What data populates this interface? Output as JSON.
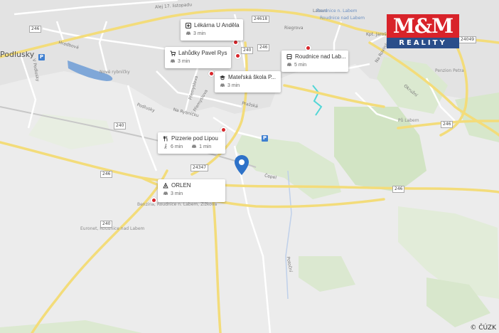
{
  "map": {
    "copyright": "© ČÚZK",
    "logo": {
      "top": "M&M",
      "bottom": "REALITY",
      "colors": {
        "red": "#d8232a",
        "blue": "#2b4e8a"
      }
    },
    "town_labels": [
      {
        "text": "Podlusky"
      }
    ],
    "street_labels": [
      "Alej 17. listopadu",
      "V Podlusky",
      "Hradbová",
      "Podlusky",
      "Na Rybníčku",
      "Přemyslova",
      "Pražská",
      "Přemyslova",
      "Riegrova",
      "Kpt. Jaroše",
      "Na Rovinách",
      "Labem",
      "Čepel",
      "Okružní",
      "Potoční"
    ],
    "small_labels": [
      "Nové rybníčky",
      "Euronet, Roudnice nad Labem",
      "Benzina, Roudnice n. Labem, Žižkova",
      "Roudnice n. Labem",
      "Roudnice nad Labem",
      "Penzion Petra",
      "Pů Labem"
    ],
    "road_shields": [
      "246",
      "240",
      "246",
      "24618",
      "240",
      "24347",
      "246",
      "246",
      "246",
      "240",
      "240",
      "24049"
    ],
    "parking_label": "P",
    "accent_color": "#2e72c8"
  },
  "cards": [
    {
      "name": "Lékárna U Anděla",
      "icon": "pharmacy-icon",
      "car": "3 min"
    },
    {
      "name": "Lahůdky Pavel Rys",
      "icon": "cart-icon",
      "car": "3 min"
    },
    {
      "name": "Mateřská škola P...",
      "icon": "school-icon",
      "car": "3 min"
    },
    {
      "name": "Roudnice nad Lab...",
      "icon": "bus-icon",
      "car": "5 min"
    },
    {
      "name": "Pizzerie pod Lipou",
      "icon": "restaurant-icon",
      "walk": "6 min",
      "car": "1 min"
    },
    {
      "name": "ORLEN",
      "icon": "fuel-station-icon",
      "car": "3 min"
    }
  ]
}
